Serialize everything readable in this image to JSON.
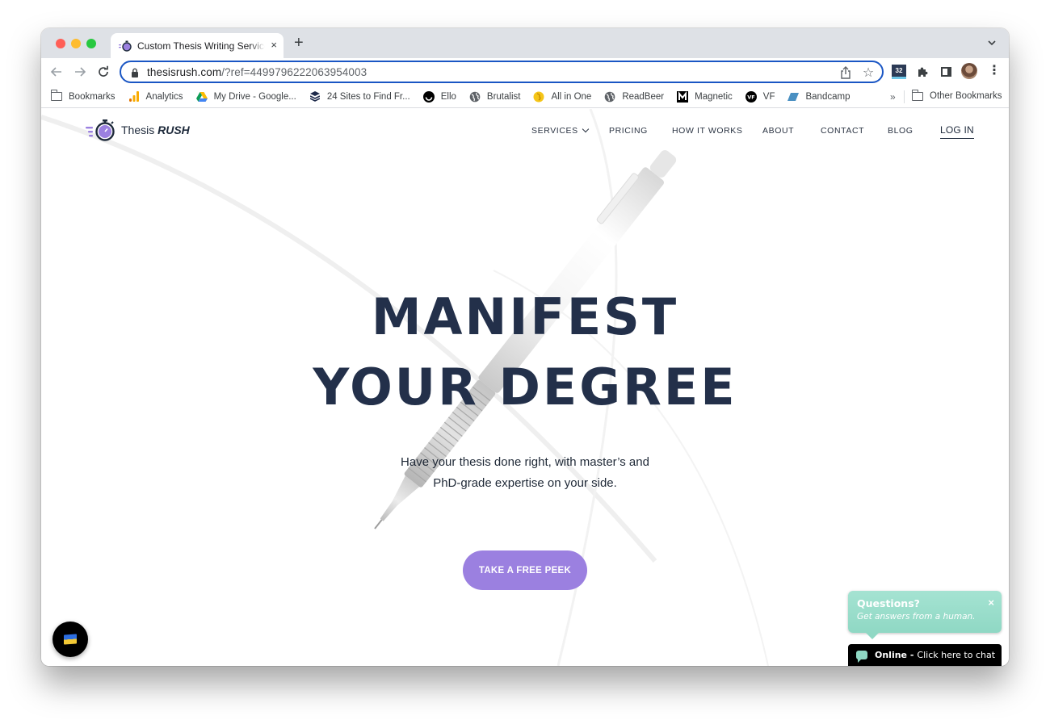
{
  "browser": {
    "tab": {
      "title": "Custom Thesis Writing Services",
      "close_icon": "×"
    },
    "new_tab_icon": "+",
    "tab_dropdown": "chevron-down",
    "address": {
      "domain": "thesisrush.com",
      "path": "/?ref=4499796222063954003"
    },
    "extension_badge": "32",
    "bookmarks": [
      {
        "label": "Bookmarks",
        "icon": "folder-icon"
      },
      {
        "label": "Analytics",
        "icon": "analytics-icon"
      },
      {
        "label": "My Drive - Google...",
        "icon": "google-drive-icon"
      },
      {
        "label": "24 Sites to Find Fr...",
        "icon": "stack-icon"
      },
      {
        "label": "Ello",
        "icon": "ello-icon"
      },
      {
        "label": "Brutalist",
        "icon": "globe-icon"
      },
      {
        "label": "All in One",
        "icon": "all-in-one-icon"
      },
      {
        "label": "ReadBeer",
        "icon": "globe-icon"
      },
      {
        "label": "Magnetic",
        "icon": "magnetic-icon"
      },
      {
        "label": "VF",
        "icon": "vf-icon"
      },
      {
        "label": "Bandcamp",
        "icon": "bandcamp-icon"
      }
    ],
    "bookmarks_overflow": "»",
    "other_bookmarks": "Other Bookmarks"
  },
  "site": {
    "logo": {
      "text_regular": "Thesis",
      "text_bold": "RUSH"
    },
    "nav": [
      {
        "label": "SERVICES",
        "has_dropdown": true
      },
      {
        "label": "PRICING"
      },
      {
        "label": "HOW IT WORKS"
      },
      {
        "label": "ABOUT"
      },
      {
        "label": "CONTACT"
      },
      {
        "label": "BLOG"
      },
      {
        "label": "LOG IN"
      }
    ],
    "hero": {
      "title_line1": "MANIFEST",
      "title_line2": "YOUR DEGREE",
      "subtitle_line1": "Have your thesis done right, with master’s and",
      "subtitle_line2": "PhD-grade expertise on your side.",
      "cta": "TAKE A FREE PEEK"
    },
    "chat": {
      "bubble_title": "Questions?",
      "bubble_subtitle": "Get answers from a human.",
      "close_icon": "×",
      "status": "Online -",
      "action": "Click here to chat"
    }
  },
  "colors": {
    "accent": "#9b80e0",
    "heading": "#23304a",
    "chat": "#8fd8c4",
    "omnibox_focus": "#1a56c4"
  }
}
